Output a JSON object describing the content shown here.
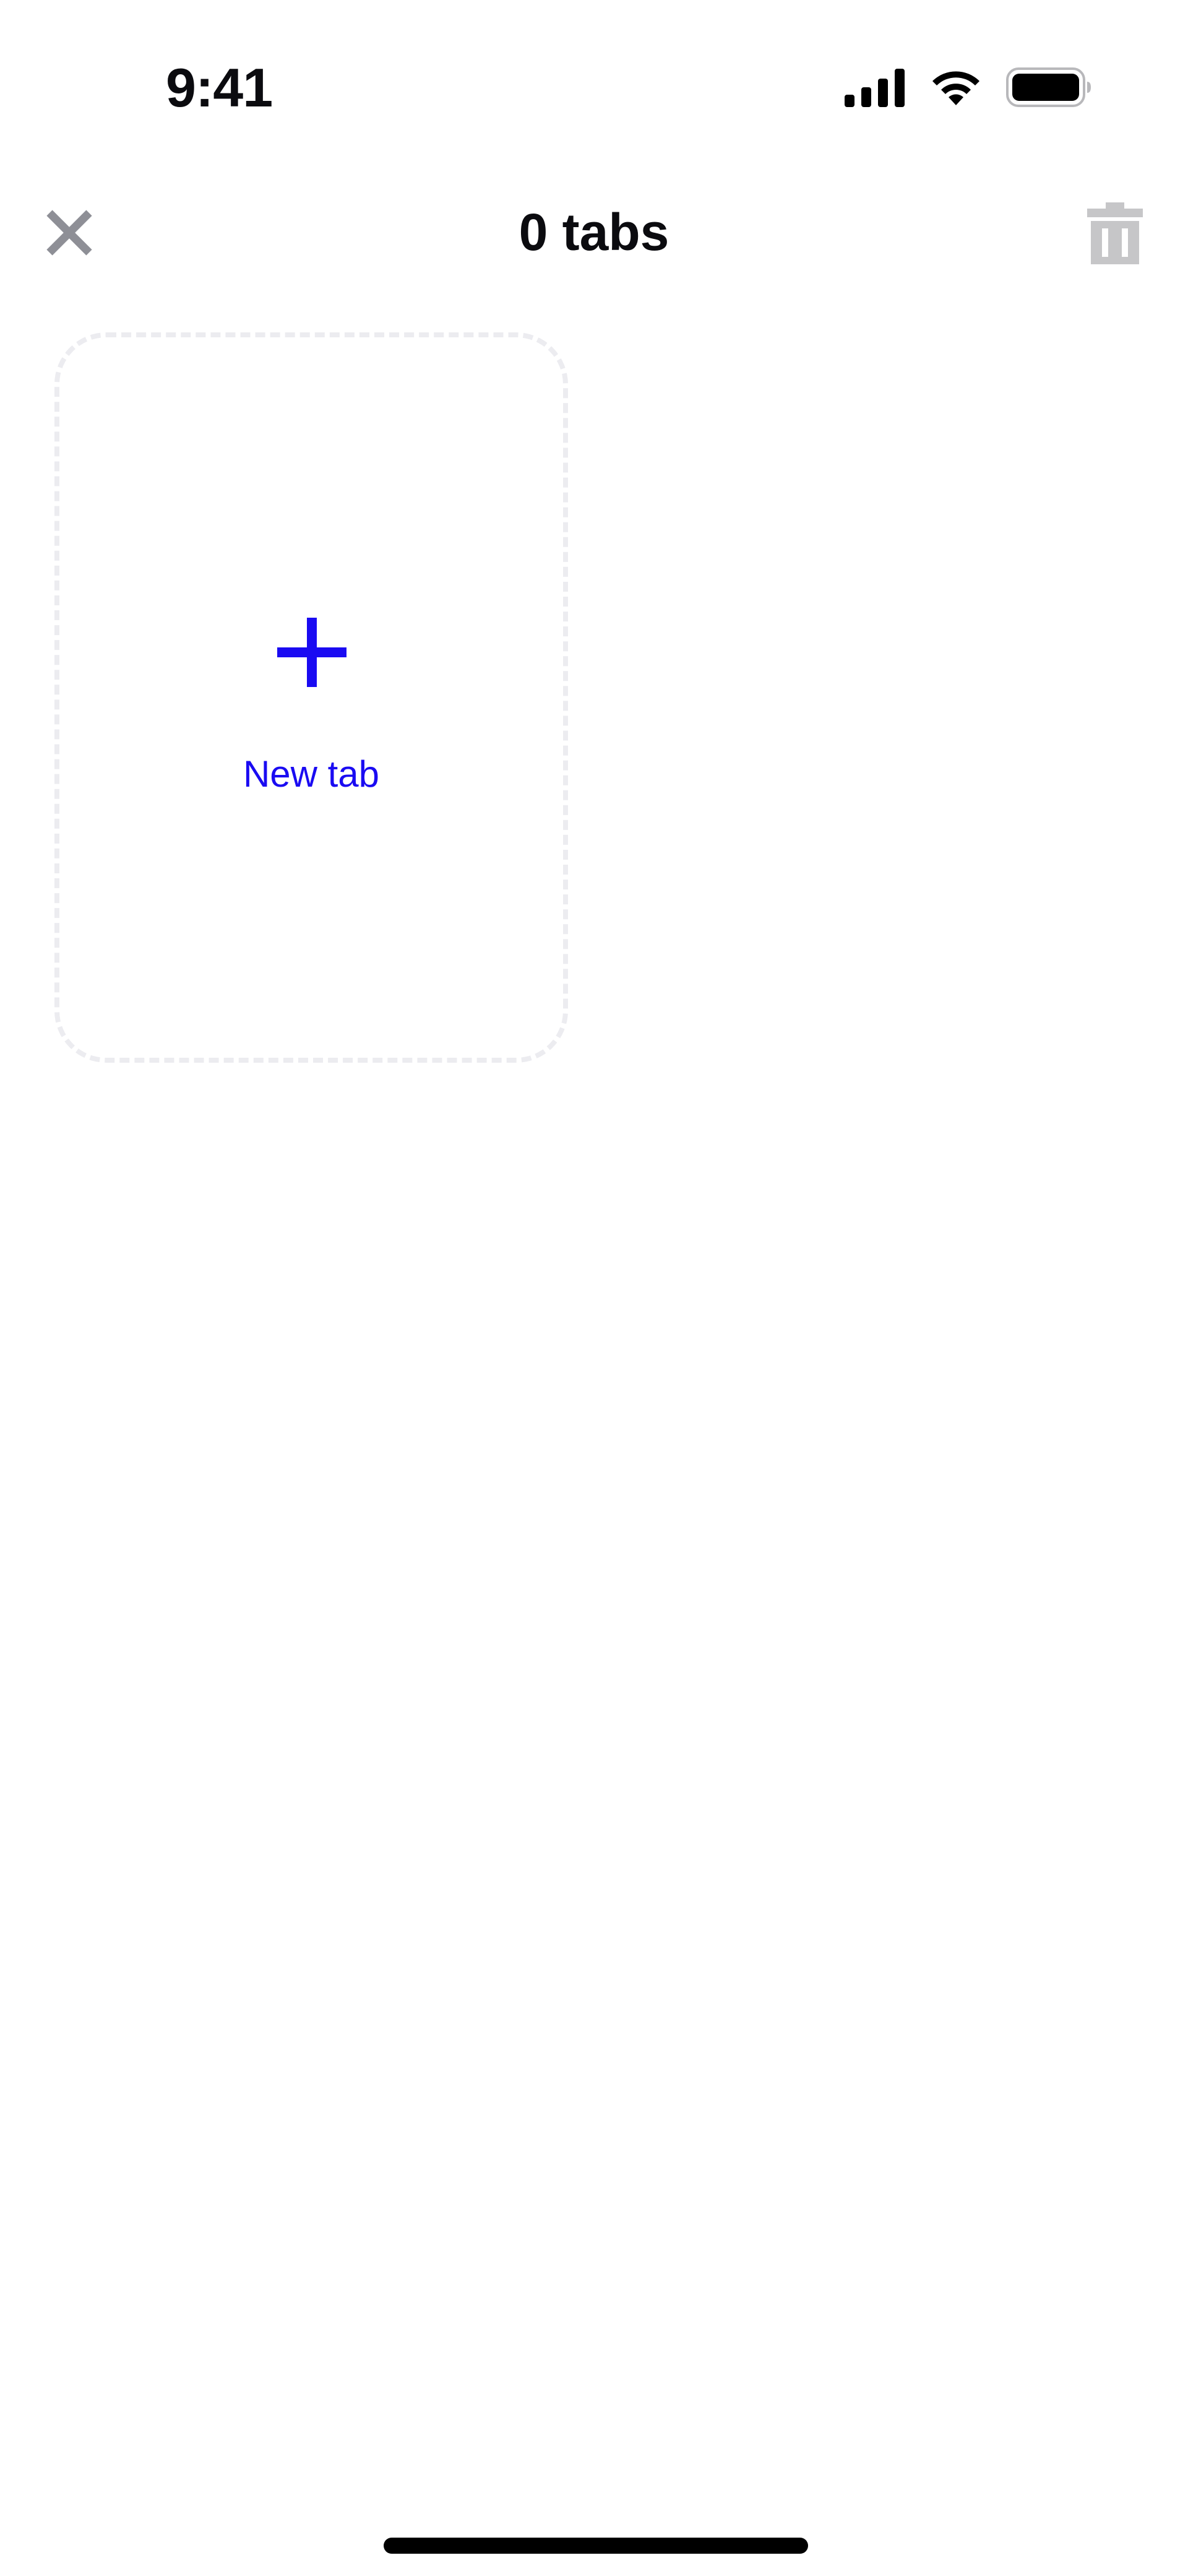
{
  "status_bar": {
    "time": "9:41",
    "icons": [
      "cellular-signal-icon",
      "wifi-icon",
      "battery-icon"
    ]
  },
  "header": {
    "title": "0 tabs",
    "close_icon": "close-icon",
    "trash_icon": "trash-icon"
  },
  "new_tab": {
    "label": "New tab",
    "icon": "plus-icon"
  },
  "colors": {
    "accent": "#1a0bf2",
    "icon_gray": "#8e8f96",
    "trash_gray": "#c6c6c8",
    "card_border": "#ececf0",
    "text": "#0b0b0f",
    "background": "#ffffff"
  }
}
